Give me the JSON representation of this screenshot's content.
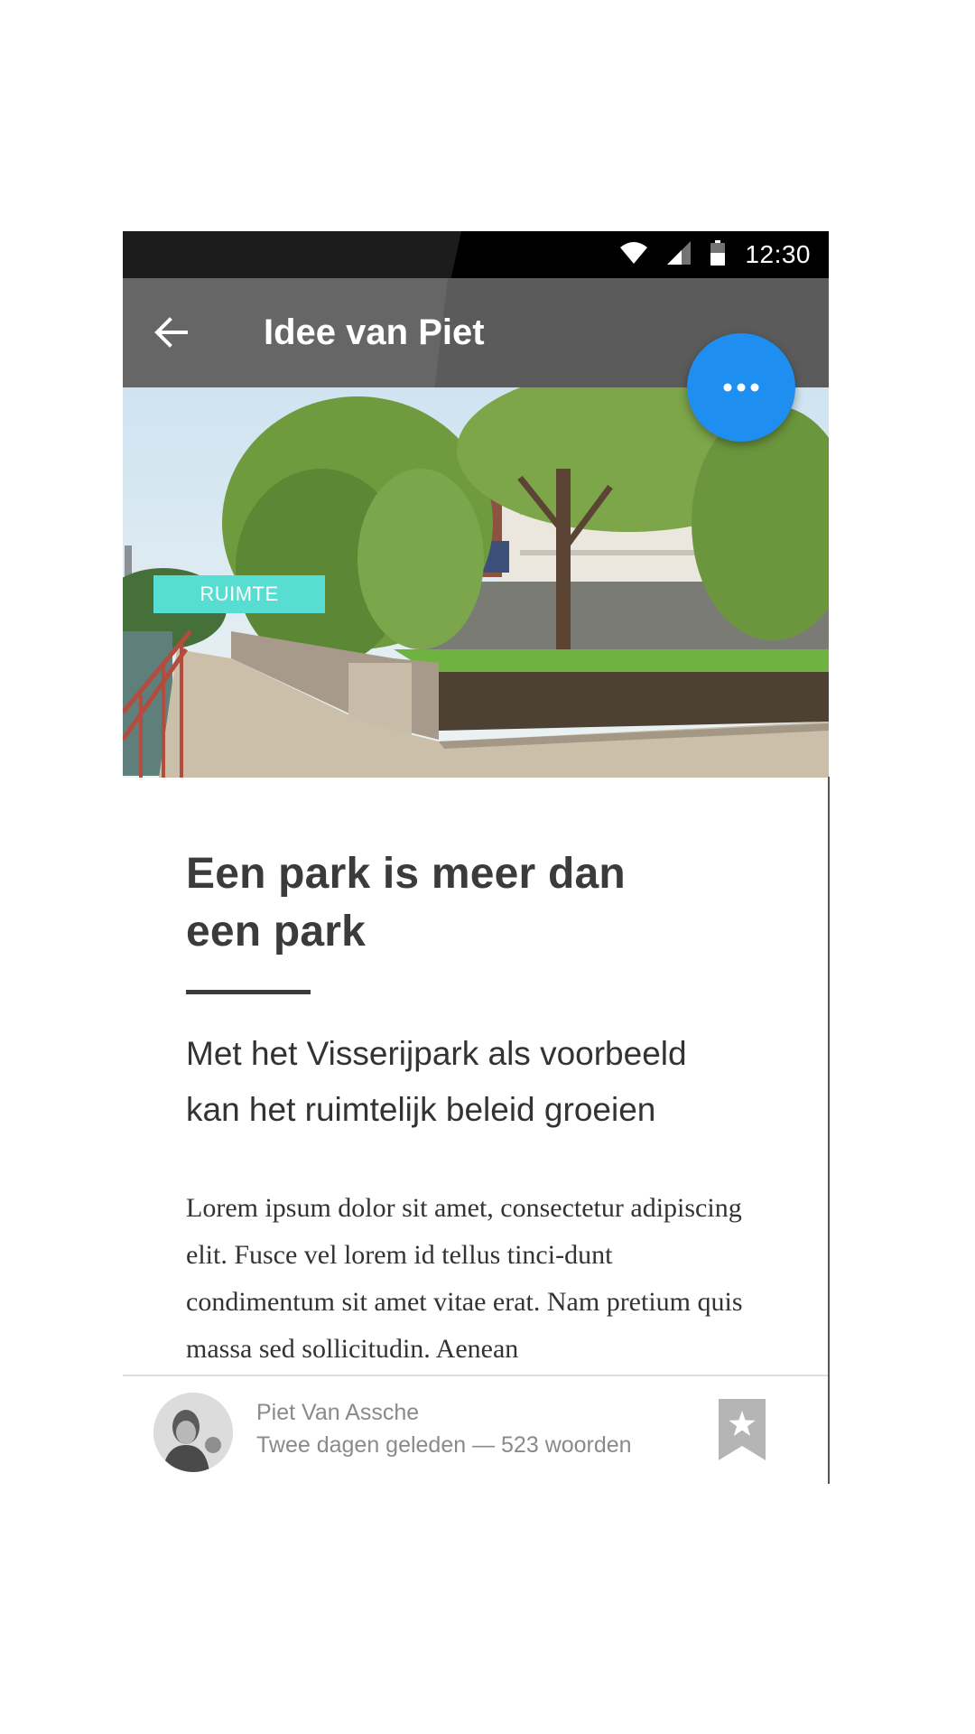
{
  "status_bar": {
    "time": "12:30",
    "icons": [
      "wifi-icon",
      "signal-icon",
      "battery-icon"
    ]
  },
  "app_bar": {
    "title": "Idee van Piet",
    "back_icon": "arrow-back-icon"
  },
  "hero": {
    "tag": "RUIMTE",
    "tag_color": "#57ddd2"
  },
  "fab": {
    "icon": "more-horizontal-icon",
    "color": "#1e8ef0"
  },
  "article": {
    "headline_line1": "Een park is meer dan",
    "headline_line2": "een park",
    "subtitle_line1": "Met het Visserijpark als voorbeeld",
    "subtitle_line2": "kan het ruimtelijk beleid groeien",
    "body": "Lorem ipsum dolor sit amet, consectetur adipiscing elit. Fusce vel lorem id tellus tinci-dunt condimentum sit amet vitae erat. Nam pretium quis massa sed sollicitudin. Aenean"
  },
  "author": {
    "name": "Piet Van Assche",
    "meta": "Twee dagen geleden — 523 woorden",
    "bookmark_icon": "bookmark-star-icon"
  }
}
